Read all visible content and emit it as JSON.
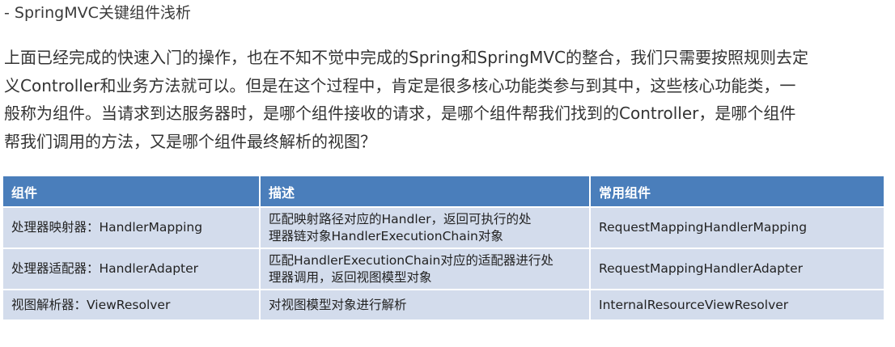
{
  "heading": "- SpringMVC关键组件浅析",
  "paragraph_lines": [
    "上面已经完成的快速入门的操作，也在不知不觉中完成的Spring和SpringMVC的整合，我们只需要按照规则去定",
    "义Controller和业务方法就可以。但是在这个过程中，肯定是很多核心功能类参与到其中，这些核心功能类，一",
    "般称为组件。当请求到达服务器时，是哪个组件接收的请求，是哪个组件帮我们找到的Controller，是哪个组件",
    "帮我们调用的方法，又是哪个组件最终解析的视图？"
  ],
  "table": {
    "headers": [
      "组件",
      "描述",
      "常用组件"
    ],
    "rows": [
      {
        "component": "处理器映射器：HandlerMapping",
        "description_lines": [
          "匹配映射路径对应的Handler，返回可执行的处",
          "理器链对象HandlerExecutionChain对象"
        ],
        "common": "RequestMappingHandlerMapping"
      },
      {
        "component": "处理器适配器：HandlerAdapter",
        "description_lines": [
          "匹配HandlerExecutionChain对应的适配器进行处",
          "理器调用，返回视图模型对象"
        ],
        "common": "RequestMappingHandlerAdapter"
      },
      {
        "component": "视图解析器：ViewResolver",
        "description_lines": [
          "对视图模型对象进行解析"
        ],
        "common": "InternalResourceViewResolver"
      }
    ]
  },
  "colors": {
    "header_bg": "#4a7ebb",
    "cell_bg": "#d3dcec",
    "header_text": "#ffffff"
  }
}
